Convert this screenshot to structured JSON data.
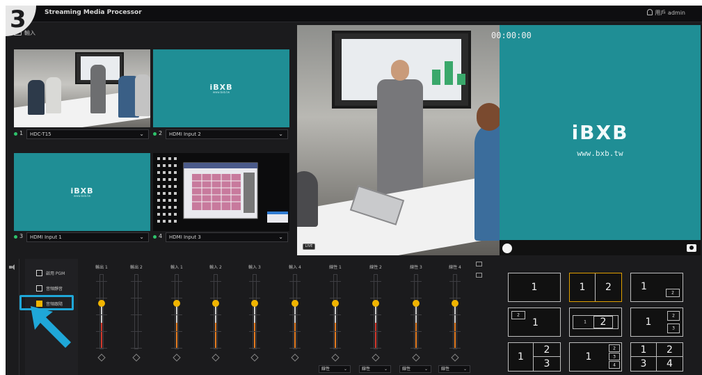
{
  "step_number": "3",
  "app": {
    "title": "Streaming Media Processor",
    "user_label": "用戶",
    "user_name": "admin"
  },
  "input_panel": {
    "heading": "輸入",
    "sources": [
      {
        "index": "1",
        "name": "HDC-T15"
      },
      {
        "index": "2",
        "name": "HDMI Input 2"
      },
      {
        "index": "3",
        "name": "HDMI Input 1"
      },
      {
        "index": "4",
        "name": "HDMI Input 3"
      }
    ],
    "logo_text": "iBXB",
    "logo_sub": "www.bxb.tw"
  },
  "monitor": {
    "timecode": "00:00:00",
    "logo_text": "iBXB",
    "logo_url": "www.bxb.tw",
    "live_tag": "LIVE"
  },
  "audio_options": [
    {
      "label": "啟用 PGM",
      "checked": false
    },
    {
      "label": "音頻靜音",
      "checked": false
    },
    {
      "label": "音頻跟隨",
      "checked": true
    }
  ],
  "mixer": {
    "channels": [
      {
        "label": "輸出 1",
        "level": 0.62,
        "fill": "#d43a2e",
        "dropdown": ""
      },
      {
        "label": "輸出 2",
        "level": null,
        "fill": "",
        "dropdown": ""
      },
      {
        "label": "輸入 1",
        "level": 0.62,
        "fill": "#e67e22",
        "dropdown": ""
      },
      {
        "label": "輸入 2",
        "level": 0.62,
        "fill": "#e67e22",
        "dropdown": ""
      },
      {
        "label": "輸入 3",
        "level": 0.62,
        "fill": "#e67e22",
        "dropdown": ""
      },
      {
        "label": "輸入 4",
        "level": 0.62,
        "fill": "#e67e22",
        "dropdown": ""
      },
      {
        "label": "線性 1",
        "level": 0.62,
        "fill": "#e67e22",
        "dropdown": "線性"
      },
      {
        "label": "線性 2",
        "level": 0.62,
        "fill": "#d43a2e",
        "dropdown": "線性"
      },
      {
        "label": "線性 3",
        "level": 0.62,
        "fill": "#e67e22",
        "dropdown": "線性"
      },
      {
        "label": "線性 4",
        "level": 0.62,
        "fill": "#e67e22",
        "dropdown": "線性"
      }
    ]
  },
  "layouts": [
    {
      "kind": "single",
      "labels": [
        "1"
      ]
    },
    {
      "kind": "side-by-side",
      "labels": [
        "1",
        "2"
      ],
      "active": true
    },
    {
      "kind": "pip-bottom-right",
      "labels": [
        "1",
        "2"
      ]
    },
    {
      "kind": "pip-top-left",
      "labels": [
        "2",
        "1"
      ]
    },
    {
      "kind": "pip-center-wide",
      "labels": [
        "1",
        "2"
      ]
    },
    {
      "kind": "one-plus-two-right",
      "labels": [
        "1",
        "2",
        "3"
      ]
    },
    {
      "kind": "one-left-two-right",
      "labels": [
        "1",
        "2",
        "3"
      ]
    },
    {
      "kind": "one-left-three-right",
      "labels": [
        "1",
        "2",
        "3",
        "4"
      ]
    },
    {
      "kind": "quad",
      "labels": [
        "1",
        "2",
        "3",
        "4"
      ]
    }
  ],
  "colors": {
    "accent": "#f0b400",
    "teal": "#1f8e95",
    "highlight": "#1fa7d8"
  },
  "icons": {
    "input": "folder-icon",
    "user": "user-icon",
    "audio": "speaker-icon",
    "snapshot": "camera-icon",
    "record": "record-icon",
    "callout": "arrow-pointer-icon"
  }
}
